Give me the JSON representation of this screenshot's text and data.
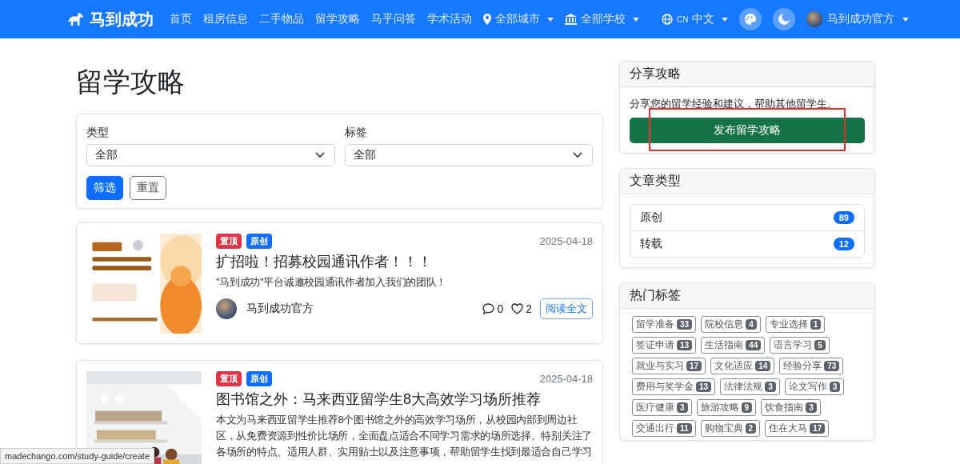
{
  "navbar": {
    "brand": "马到成功",
    "links": [
      {
        "label": "首页",
        "kind": "link"
      },
      {
        "label": "租房信息",
        "kind": "link"
      },
      {
        "label": "二手物品",
        "kind": "link"
      },
      {
        "label": "留学攻略",
        "kind": "link"
      },
      {
        "label": "马乎问答",
        "kind": "link"
      },
      {
        "label": "学术活动",
        "kind": "link"
      },
      {
        "label": "全部城市",
        "kind": "city"
      },
      {
        "label": "全部学校",
        "kind": "school"
      }
    ],
    "lang_code": "CN",
    "lang": "中文",
    "user": "马到成功官方"
  },
  "page_title": "留学攻略",
  "filters": {
    "fields": [
      {
        "label": "类型",
        "value": "全部"
      },
      {
        "label": "标签",
        "value": "全部"
      }
    ],
    "buttons": [
      {
        "label": "筛选",
        "kind": "primary"
      },
      {
        "label": "重置",
        "kind": "outline"
      }
    ]
  },
  "articles": [
    {
      "badges": [
        {
          "label": "置顶",
          "color": "#dc3545"
        },
        {
          "label": "原创",
          "color": "#0d6efd"
        }
      ],
      "date": "2025-04-18",
      "title": "扩招啦！招募校园通讯作者！！！",
      "summary": "\"马到成功\"平台诚邀校园通讯作者加入我们的团队！",
      "author": "马到成功官方",
      "comments": "0",
      "likes": "2",
      "read": "阅读全文"
    },
    {
      "badges": [
        {
          "label": "置顶",
          "color": "#dc3545"
        },
        {
          "label": "原创",
          "color": "#0d6efd"
        }
      ],
      "date": "2025-04-18",
      "title": "图书馆之外：马来西亚留学生8大高效学习场所推荐",
      "summary": "本文为马来西亚留学生推荐8个图书馆之外的高效学习场所，从校园内部到周边社区，从免费资源到性价比场所，全面盘点适合不同学习需求的场所选择。特别关注了各场所的特点、适用人群、实用贴士以及注意事项，帮助留学生找到最适合自己学习"
    }
  ],
  "share": {
    "title": "分享攻略",
    "text": "分享您的留学经验和建议，帮助其他留学生。",
    "button": "发布留学攻略",
    "annotated": true
  },
  "types": {
    "title": "文章类型",
    "items": [
      {
        "label": "原创",
        "count": "89"
      },
      {
        "label": "转载",
        "count": "12"
      }
    ]
  },
  "tags": {
    "title": "热门标签",
    "items": [
      {
        "label": "留学准备",
        "count": "33"
      },
      {
        "label": "院校信息",
        "count": "4"
      },
      {
        "label": "专业选择",
        "count": "1"
      },
      {
        "label": "签证申请",
        "count": "13"
      },
      {
        "label": "生活指南",
        "count": "44"
      },
      {
        "label": "语言学习",
        "count": "5"
      },
      {
        "label": "就业与实习",
        "count": "17"
      },
      {
        "label": "文化适应",
        "count": "14"
      },
      {
        "label": "经验分享",
        "count": "73"
      },
      {
        "label": "费用与奖学金",
        "count": "13"
      },
      {
        "label": "法律法规",
        "count": "3"
      },
      {
        "label": "论文写作",
        "count": "3"
      },
      {
        "label": "医疗健康",
        "count": "3"
      },
      {
        "label": "旅游攻略",
        "count": "9"
      },
      {
        "label": "饮食指南",
        "count": "3"
      },
      {
        "label": "交通出行",
        "count": "11"
      },
      {
        "label": "购物宝典",
        "count": "2"
      },
      {
        "label": "住在大马",
        "count": "17"
      }
    ]
  },
  "status_url": "madechango.com/study-guide/create"
}
